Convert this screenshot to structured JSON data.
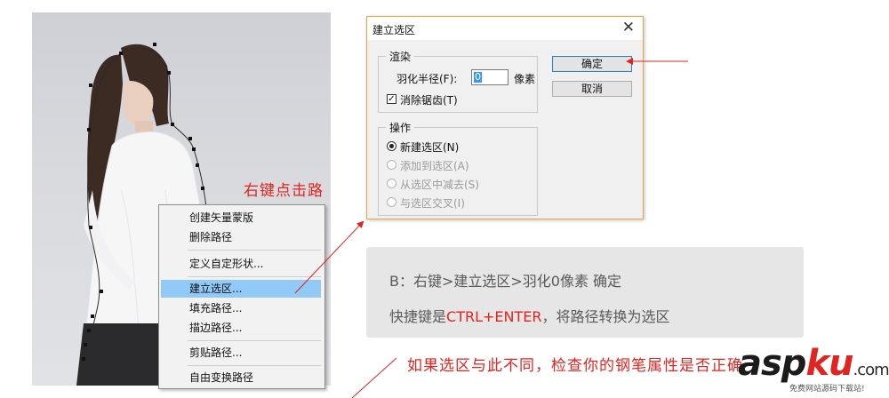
{
  "photo": {
    "annotation": "右键点击路径"
  },
  "context_menu": {
    "items": [
      {
        "label": "创建矢量蒙版",
        "highlighted": false
      },
      {
        "label": "删除路径",
        "highlighted": false
      },
      {
        "label": "定义自定形状...",
        "highlighted": false
      },
      {
        "label": "建立选区...",
        "highlighted": true
      },
      {
        "label": "填充路径...",
        "highlighted": false
      },
      {
        "label": "描边路径...",
        "highlighted": false
      },
      {
        "label": "剪贴路径...",
        "highlighted": false
      },
      {
        "label": "自由变换路径",
        "highlighted": false
      }
    ]
  },
  "dialog": {
    "title": "建立选区",
    "close_icon": "close-icon",
    "render": {
      "legend": "渲染",
      "feather_label": "羽化半径(F):",
      "feather_value": "0",
      "feather_unit": "像素",
      "antialias_label": "消除锯齿(T)",
      "antialias_checked": true
    },
    "operation": {
      "legend": "操作",
      "options": [
        {
          "label": "新建选区(N)",
          "selected": true,
          "enabled": true
        },
        {
          "label": "添加到选区(A)",
          "selected": false,
          "enabled": false
        },
        {
          "label": "从选区中减去(S)",
          "selected": false,
          "enabled": false
        },
        {
          "label": "与选区交叉(I)",
          "selected": false,
          "enabled": false
        }
      ]
    },
    "ok_label": "确定",
    "cancel_label": "取消"
  },
  "info": {
    "line1": "B：右键>建立选区>羽化0像素  确定",
    "line2_prefix": "快捷键是",
    "line2_shortcut": "CTRL+ENTER",
    "line2_suffix": "，将路径转换为选区"
  },
  "warning": "如果选区与此不同，检查你的钢笔属性是否正确",
  "logo": {
    "asp": "asp",
    "ku": "ku",
    "dotcom": ".com",
    "tagline": "免费网站源码下载站!"
  },
  "colors": {
    "annotation_red": "#e0241f",
    "menu_highlight": "#91c9f7",
    "dialog_border": "#f2a444"
  }
}
